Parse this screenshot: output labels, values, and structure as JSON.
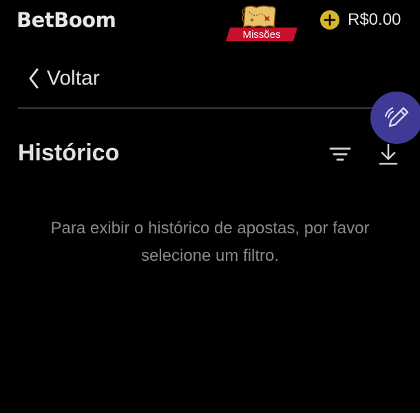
{
  "header": {
    "logo": "BetBoom",
    "missions_label": "Missões",
    "balance": "R$0.00"
  },
  "nav": {
    "back_label": "Voltar"
  },
  "page": {
    "title": "Histórico",
    "empty_message": "Para exibir o histórico de apostas, por favor selecione um filtro."
  },
  "icons": {
    "missions": "treasure-map-icon",
    "add_funds": "plus-circle-icon",
    "back": "chevron-left-icon",
    "fab": "pencil-icon",
    "filter": "filter-icon",
    "download": "download-icon"
  },
  "colors": {
    "background": "#000000",
    "accent_yellow": "#d4b62c",
    "missions_red": "#c8102e",
    "fab_purple": "#3f3a96",
    "muted_text": "#8a8a8a"
  }
}
